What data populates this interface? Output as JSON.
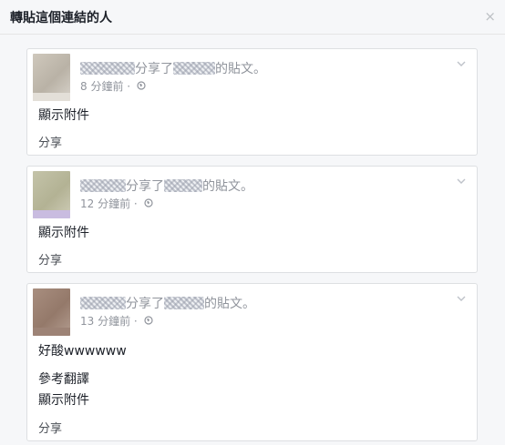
{
  "dialog": {
    "title": "轉貼這個連結的人",
    "close_glyph": "×"
  },
  "posts": [
    {
      "shared_text": "分享了",
      "post_suffix": "的貼文。",
      "time": "8 分鐘前 ·",
      "body": "",
      "translate": "",
      "attachment": "顯示附件",
      "share": "分享"
    },
    {
      "shared_text": "分享了",
      "post_suffix": "的貼文。",
      "time": "12 分鐘前 ·",
      "body": "",
      "translate": "",
      "attachment": "顯示附件",
      "share": "分享"
    },
    {
      "shared_text": "分享了",
      "post_suffix": "的貼文。",
      "time": "13 分鐘前 ·",
      "body": "好酸wwwwww",
      "translate": "參考翻譯",
      "attachment": "顯示附件",
      "share": "分享"
    }
  ],
  "icons": {
    "globe": "globe-icon",
    "chevron": "chevron-down-icon",
    "close": "close-icon"
  },
  "colors": {
    "text_primary": "#1d2129",
    "text_secondary": "#90949c",
    "border": "#dddfe2",
    "background": "#f6f7f9"
  }
}
